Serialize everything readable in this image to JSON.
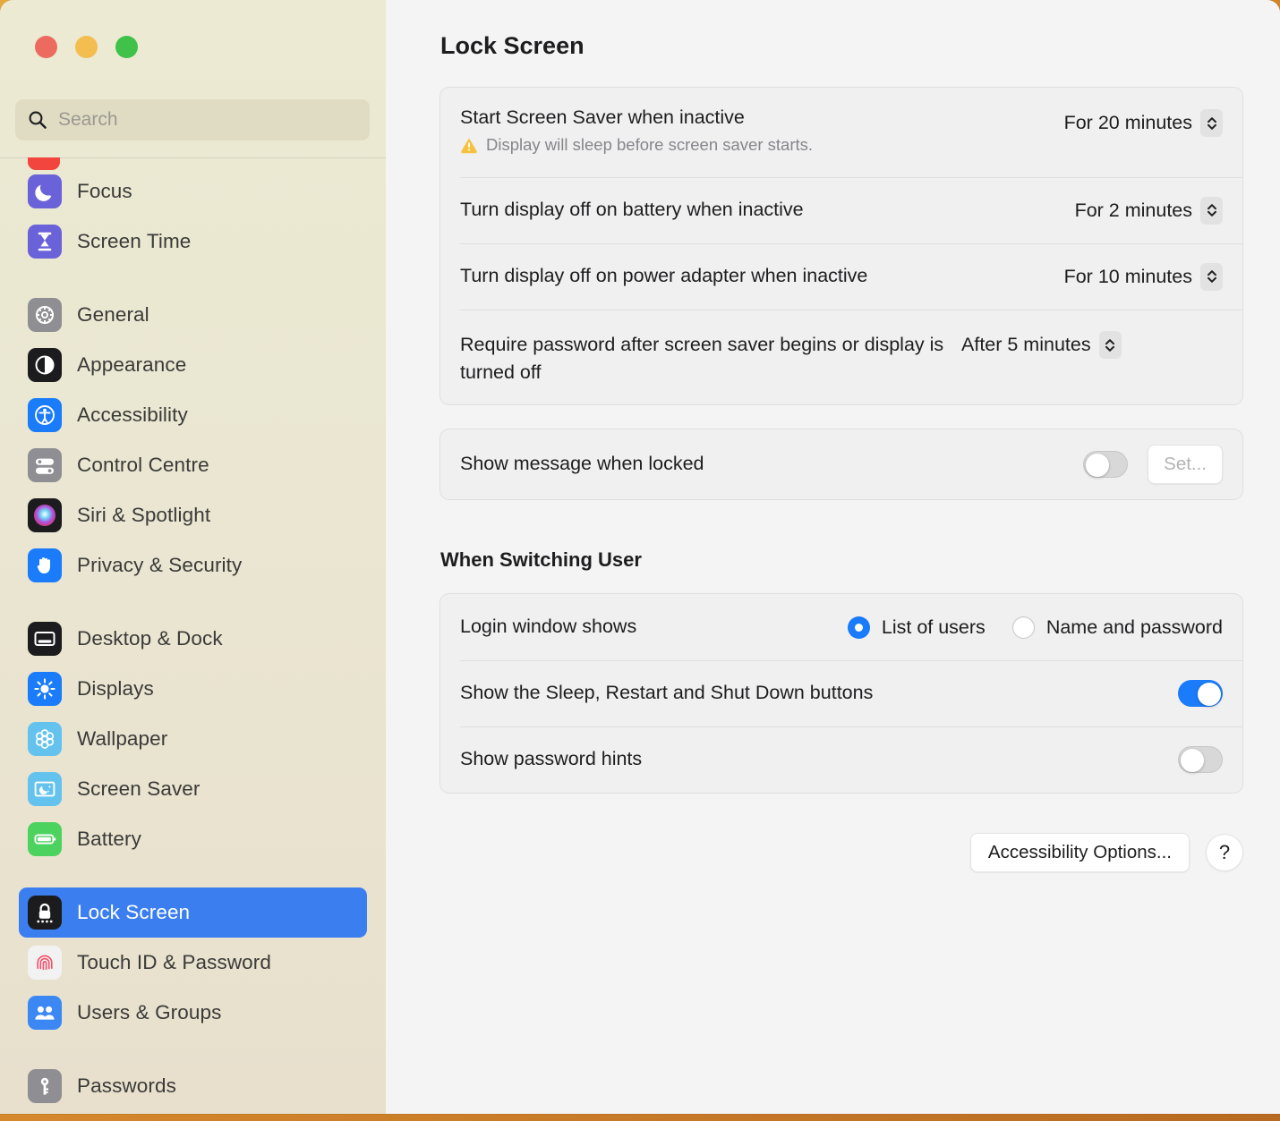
{
  "window": {
    "traffic_lights": {
      "close": "close-button",
      "minimize": "minimize-button",
      "maximize": "maximize-button"
    }
  },
  "sidebar": {
    "search": {
      "placeholder": "Search",
      "value": "",
      "icon": "search-icon"
    },
    "groups": [
      {
        "items": [
          {
            "label": "Focus",
            "icon": "focus-moon-icon",
            "selected": false
          },
          {
            "label": "Screen Time",
            "icon": "screen-time-hourglass-icon",
            "selected": false
          }
        ]
      },
      {
        "items": [
          {
            "label": "General",
            "icon": "general-gear-icon",
            "selected": false
          },
          {
            "label": "Appearance",
            "icon": "appearance-contrast-icon",
            "selected": false
          },
          {
            "label": "Accessibility",
            "icon": "accessibility-person-icon",
            "selected": false
          },
          {
            "label": "Control Centre",
            "icon": "control-centre-sliders-icon",
            "selected": false
          },
          {
            "label": "Siri & Spotlight",
            "icon": "siri-orb-icon",
            "selected": false
          },
          {
            "label": "Privacy & Security",
            "icon": "privacy-hand-icon",
            "selected": false
          }
        ]
      },
      {
        "items": [
          {
            "label": "Desktop & Dock",
            "icon": "desktop-dock-icon",
            "selected": false
          },
          {
            "label": "Displays",
            "icon": "displays-sun-icon",
            "selected": false
          },
          {
            "label": "Wallpaper",
            "icon": "wallpaper-flower-icon",
            "selected": false
          },
          {
            "label": "Screen Saver",
            "icon": "screen-saver-moon-icon",
            "selected": false
          },
          {
            "label": "Battery",
            "icon": "battery-icon",
            "selected": false
          }
        ]
      },
      {
        "items": [
          {
            "label": "Lock Screen",
            "icon": "lock-screen-padlock-icon",
            "selected": true
          },
          {
            "label": "Touch ID & Password",
            "icon": "touch-id-fingerprint-icon",
            "selected": false
          },
          {
            "label": "Users & Groups",
            "icon": "users-groups-people-icon",
            "selected": false
          }
        ]
      },
      {
        "items": [
          {
            "label": "Passwords",
            "icon": "passwords-key-icon",
            "selected": false
          }
        ]
      }
    ]
  },
  "main": {
    "title": "Lock Screen",
    "timing_card": {
      "screen_saver": {
        "label": "Start Screen Saver when inactive",
        "value": "For 20 minutes",
        "warning": "Display will sleep before screen saver starts.",
        "warning_icon": "warning-triangle-icon"
      },
      "display_off_battery": {
        "label": "Turn display off on battery when inactive",
        "value": "For 2 minutes"
      },
      "display_off_adapter": {
        "label": "Turn display off on power adapter when inactive",
        "value": "For 10 minutes"
      },
      "require_password": {
        "label": "Require password after screen saver begins or display is turned off",
        "value": "After 5 minutes"
      }
    },
    "message_card": {
      "label": "Show message when locked",
      "toggle_on": false,
      "set_button": "Set..."
    },
    "switching_user": {
      "heading": "When Switching User",
      "login_window": {
        "label": "Login window shows",
        "options": [
          {
            "label": "List of users",
            "selected": true
          },
          {
            "label": "Name and password",
            "selected": false
          }
        ]
      },
      "sleep_restart_shutdown": {
        "label": "Show the Sleep, Restart and Shut Down buttons",
        "toggle_on": true
      },
      "password_hints": {
        "label": "Show password hints",
        "toggle_on": false
      }
    },
    "footer": {
      "accessibility_options": "Accessibility Options...",
      "help": "?"
    }
  },
  "colors": {
    "accent_blue": "#1a7bfb",
    "selection_blue": "#3b7ef0",
    "warning_yellow": "#f5c141",
    "sidebar_bg": "#eae6d2",
    "main_bg": "#f4f4f4",
    "card_bg": "#f0f0f0"
  }
}
